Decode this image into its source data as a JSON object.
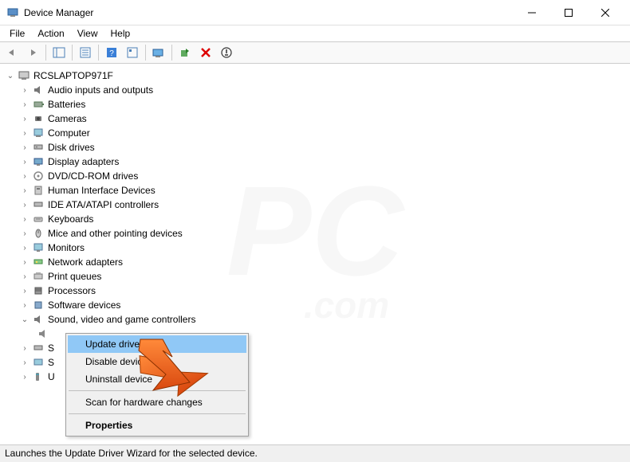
{
  "window": {
    "title": "Device Manager"
  },
  "menus": {
    "file": "File",
    "action": "Action",
    "view": "View",
    "help": "Help"
  },
  "tree": {
    "root": "RCSLAPTOP971F",
    "items": [
      "Audio inputs and outputs",
      "Batteries",
      "Cameras",
      "Computer",
      "Disk drives",
      "Display adapters",
      "DVD/CD-ROM drives",
      "Human Interface Devices",
      "IDE ATA/ATAPI controllers",
      "Keyboards",
      "Mice and other pointing devices",
      "Monitors",
      "Network adapters",
      "Print queues",
      "Processors",
      "Software devices",
      "Sound, video and game controllers"
    ],
    "partial": [
      "S",
      "S",
      "U"
    ]
  },
  "context_menu": {
    "update": "Update driver",
    "disable": "Disable device",
    "uninstall": "Uninstall device",
    "scan": "Scan for hardware changes",
    "properties": "Properties"
  },
  "statusbar": {
    "text": "Launches the Update Driver Wizard for the selected device."
  }
}
